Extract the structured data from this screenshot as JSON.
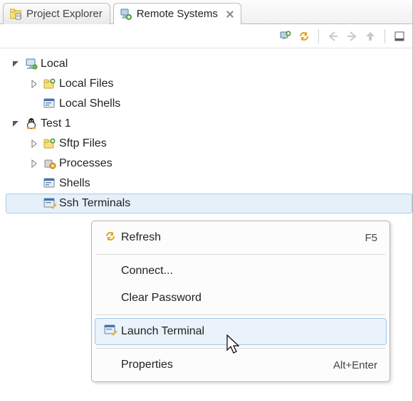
{
  "tabs": {
    "project_explorer": "Project Explorer",
    "remote_systems": "Remote Systems"
  },
  "tree": {
    "local": {
      "label": "Local",
      "files": "Local Files",
      "shells": "Local Shells"
    },
    "test1": {
      "label": "Test 1",
      "sftp": "Sftp Files",
      "processes": "Processes",
      "shells": "Shells",
      "ssh_terminals": "Ssh Terminals"
    }
  },
  "context_menu": {
    "refresh": {
      "label": "Refresh",
      "shortcut": "F5"
    },
    "connect": {
      "label": "Connect..."
    },
    "clear_password": {
      "label": "Clear Password"
    },
    "launch_terminal": {
      "label": "Launch Terminal"
    },
    "properties": {
      "label": "Properties",
      "shortcut": "Alt+Enter"
    }
  }
}
